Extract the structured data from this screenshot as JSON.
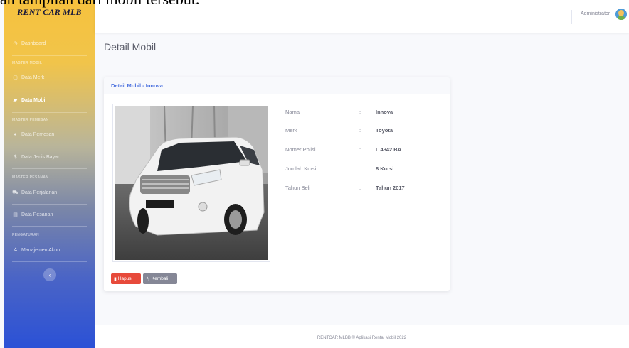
{
  "caption": "an tampilan dari mobil tersebut.",
  "brand": "RENT CAR MLB",
  "sidebar": {
    "items": [
      {
        "label": "Dashboard",
        "icon": "dashboard-icon"
      },
      {
        "label": "Data Merk",
        "icon": "tag-icon"
      },
      {
        "label": "Data Mobil",
        "icon": "car-icon"
      },
      {
        "label": "Data Pemesan",
        "icon": "user-icon"
      },
      {
        "label": "Data Jenis Bayar",
        "icon": "dollar-icon"
      },
      {
        "label": "Data Perjalanan",
        "icon": "road-icon"
      },
      {
        "label": "Data Pesanan",
        "icon": "receipt-icon"
      },
      {
        "label": "Manajemen Akun",
        "icon": "gear-icon"
      }
    ],
    "headings": [
      "MASTER MOBIL",
      "MASTER PEMESAN",
      "MASTER PESANAN",
      "PENGATURAN"
    ],
    "toggle": "‹"
  },
  "topbar": {
    "user": "Administrator"
  },
  "page_title": "Detail Mobil",
  "card": {
    "title": "Detail Mobil - Innova",
    "details": [
      {
        "label": "Nama",
        "value": "Innova"
      },
      {
        "label": "Merk",
        "value": "Toyota"
      },
      {
        "label": "Nomer Polisi",
        "value": "L 4342 BA"
      },
      {
        "label": "Jumlah Kursi",
        "value": "8 Kursi"
      },
      {
        "label": "Tahun Beli",
        "value": "Tahun 2017"
      }
    ],
    "colon": ":",
    "buttons": {
      "delete": "Hapus",
      "back": "Kembali"
    }
  },
  "footer": "RENTCAR MLBB © Aplikasi Rental Mobil 2022",
  "colors": {
    "primary": "#4e73df",
    "danger": "#e74a3b",
    "secondary": "#858796",
    "sidebar_top": "#f6c23e",
    "sidebar_bottom": "#2b51d6"
  }
}
